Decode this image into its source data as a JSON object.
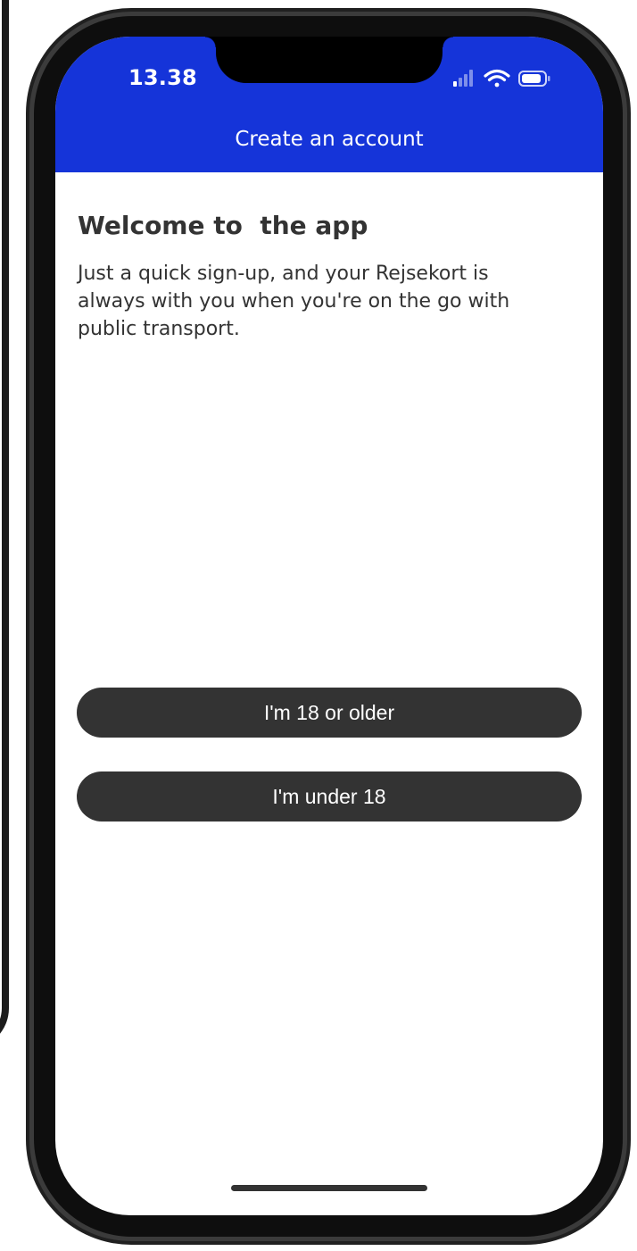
{
  "status_bar": {
    "time": "13.38",
    "icons": [
      "cellular-signal-icon",
      "wifi-icon",
      "battery-icon"
    ]
  },
  "header": {
    "title": "Create an account"
  },
  "main": {
    "heading": "Welcome to  the app",
    "body": "Just a quick sign-up, and your Rejsekort is always with you when you're on the go with public transport."
  },
  "actions": {
    "adult_label": "I'm 18 or older",
    "minor_label": "I'm under 18"
  },
  "colors": {
    "header_blue": "#1534d9",
    "button_dark": "#333333",
    "text_dark": "#333333",
    "background": "#ffffff"
  }
}
